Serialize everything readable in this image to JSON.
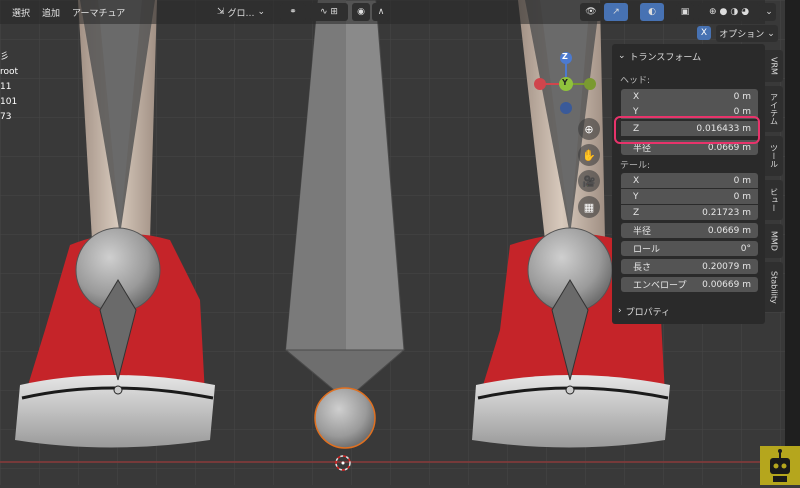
{
  "header": {
    "menu": [
      "選択",
      "追加",
      "アーマチュア"
    ],
    "orientation_label": "グロ…",
    "options_label": "オプション",
    "x_label": "X"
  },
  "stats": {
    "lines": [
      "彡",
      "root",
      "",
      "11",
      "101",
      "73"
    ]
  },
  "gizmo": {
    "x": "X",
    "y": "Y",
    "z": "Z"
  },
  "transform_panel": {
    "title": "トランスフォーム",
    "head_label": "ヘッド:",
    "head": [
      {
        "label": "X",
        "value": "0 m"
      },
      {
        "label": "Y",
        "value": "0 m"
      },
      {
        "label": "Z",
        "value": "0.016433 m"
      },
      {
        "label": "半径",
        "value": "0.0669 m"
      }
    ],
    "tail_label": "テール:",
    "tail": [
      {
        "label": "X",
        "value": "0 m"
      },
      {
        "label": "Y",
        "value": "0 m"
      },
      {
        "label": "Z",
        "value": "0.21723 m"
      }
    ],
    "tail_radius": {
      "label": "半径",
      "value": "0.0669 m"
    },
    "roll": {
      "label": "ロール",
      "value": "0°"
    },
    "length": {
      "label": "長さ",
      "value": "0.20079 m"
    },
    "envelope": {
      "label": "エンベロープ",
      "value": "0.00669 m"
    },
    "properties_title": "プロパティ"
  },
  "sidebar_tabs": [
    "VRM",
    "アイテム",
    "ツール",
    "ビュー",
    "MMD",
    "Stability"
  ],
  "colors": {
    "highlight": "#e8336b",
    "accent_blue": "#4772b3",
    "panel_bg": "#2a2a2a",
    "field_bg": "#545454",
    "shoe_red": "#c52429"
  }
}
